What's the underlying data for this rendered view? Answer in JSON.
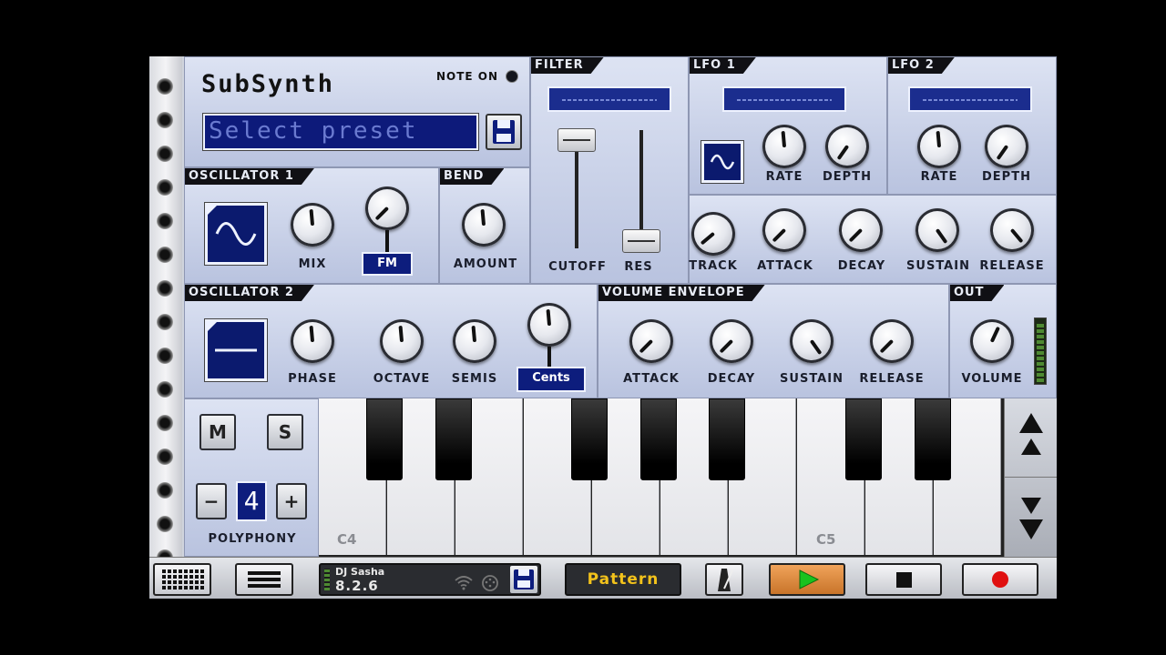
{
  "app": {
    "title": "SubSynth",
    "note_on_label": "NOTE ON",
    "preset": "Select preset"
  },
  "filter": {
    "title": "FILTER",
    "cutoff_label": "CUTOFF",
    "res_label": "RES",
    "track_label": "TRACK",
    "attack_label": "ATTACK",
    "decay_label": "DECAY",
    "sustain_label": "SUSTAIN",
    "release_label": "RELEASE"
  },
  "lfo1": {
    "title": "LFO 1",
    "rate_label": "RATE",
    "depth_label": "DEPTH"
  },
  "lfo2": {
    "title": "LFO 2",
    "rate_label": "RATE",
    "depth_label": "DEPTH"
  },
  "osc1": {
    "title": "OSCILLATOR 1",
    "mix_label": "MIX",
    "fm_label": "FM",
    "waveform": "sine-wave-icon"
  },
  "bend": {
    "title": "BEND",
    "amount_label": "AMOUNT"
  },
  "osc2": {
    "title": "OSCILLATOR 2",
    "phase_label": "PHASE",
    "octave_label": "OCTAVE",
    "semis_label": "SEMIS",
    "cents_label": "Cents",
    "waveform": "flat-wave-icon"
  },
  "volenv": {
    "title": "VOLUME ENVELOPE",
    "attack_label": "ATTACK",
    "decay_label": "DECAY",
    "sustain_label": "SUSTAIN",
    "release_label": "RELEASE"
  },
  "out": {
    "title": "OUT",
    "volume_label": "VOLUME"
  },
  "voice": {
    "mute_label": "M",
    "solo_label": "S",
    "minus_label": "−",
    "plus_label": "+",
    "polyphony_value": "4",
    "polyphony_label": "POLYPHONY"
  },
  "keyboard": {
    "labels": [
      "C4",
      "C5"
    ]
  },
  "toolbar": {
    "user_name": "DJ Sasha",
    "version": "8.2.6",
    "pattern_label": "Pattern"
  },
  "colors": {
    "accent": "#0d1d7d",
    "play": "#c8742a",
    "record": "#e01010"
  }
}
